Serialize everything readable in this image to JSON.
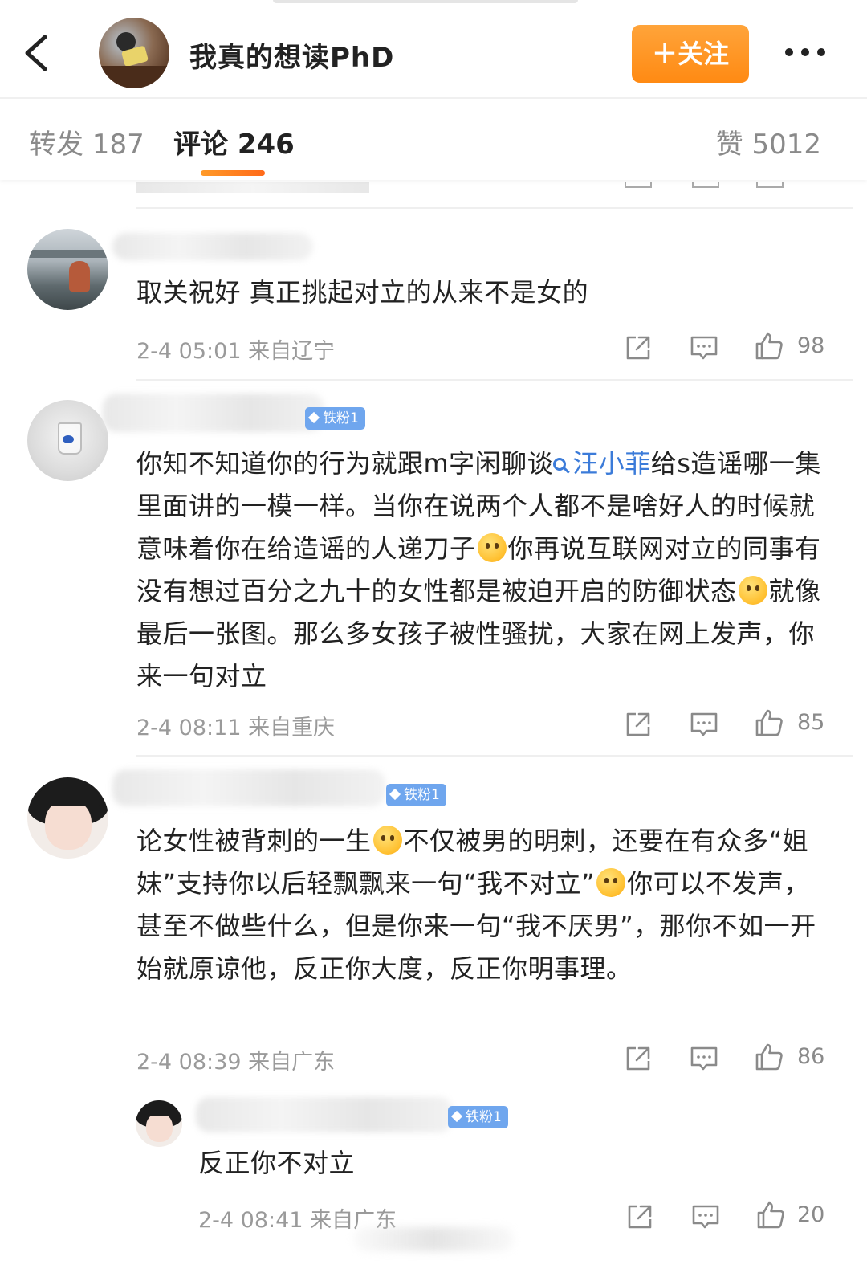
{
  "header": {
    "title": "我真的想读PhD",
    "follow_label": "＋关注"
  },
  "tabs": {
    "reposts": "转发 187",
    "comments": "评论 246",
    "likes": "赞 5012"
  },
  "comments": [
    {
      "text": "取关祝好 真正挑起对立的从来不是女的",
      "time": "2-4 05:01",
      "location": "来自辽宁",
      "likes": "98"
    },
    {
      "badge": "铁粉1",
      "text_1": "你知不知道你的行为就跟m字闲聊谈",
      "mention": "汪小菲",
      "text_2": "给s造谣哪一集里面讲的一模一样。当你在说两个人都不是啥好人的时候就意味着你在给造谣的人递刀子",
      "text_3": "你再说互联网对立的同事有没有想过百分之九十的女性都是被迫开启的防御状态",
      "text_4": "就像最后一张图。那么多女孩子被性骚扰，大家在网上发声，你来一句对立",
      "time": "2-4 08:11",
      "location": "来自重庆",
      "likes": "85"
    },
    {
      "badge": "铁粉1",
      "text_1": "论女性被背刺的一生",
      "text_2": "不仅被男的明刺，还要在有众多“姐妹”支持你以后轻飘飘来一句“我不对立”",
      "text_3": "你可以不发声，甚至不做些什么，但是你来一句“我不厌男”，那你不如一开始就原谅他，反正你大度，反正你明事理。",
      "time": "2-4 08:39",
      "location": "来自广东",
      "likes": "86"
    },
    {
      "badge": "铁粉1",
      "text": "反正你不对立",
      "time": "2-4 08:41",
      "location": "来自广东",
      "likes": "20"
    }
  ],
  "icons": {
    "back": "chevron-left-icon",
    "more": "more-dots-icon",
    "share": "share-icon",
    "comment": "comment-icon",
    "like": "thumbs-up-icon"
  },
  "colors": {
    "accent": "#ff8a13",
    "mention": "#3b7bd9",
    "badge": "#6fa6ee"
  }
}
